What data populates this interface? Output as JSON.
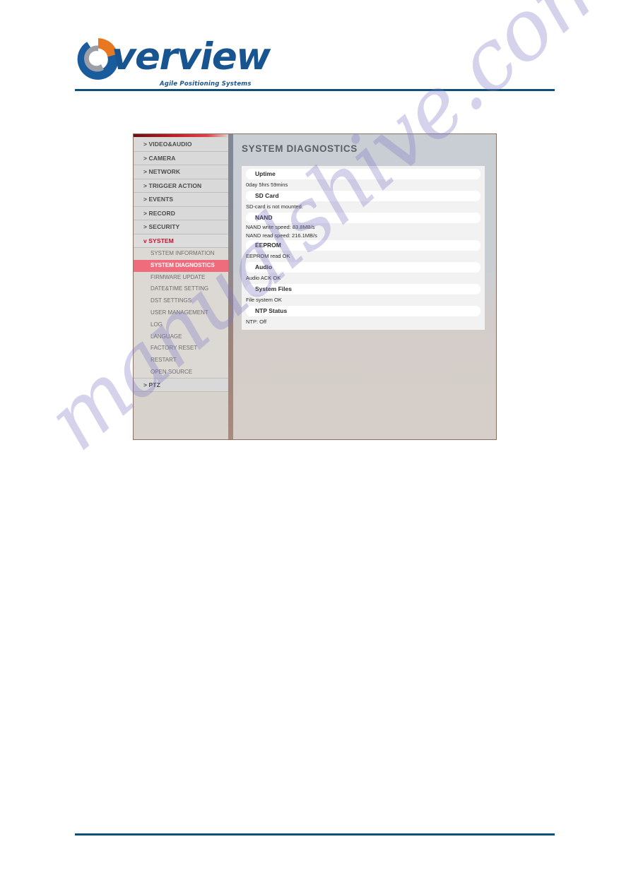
{
  "document": {
    "logo": {
      "wordmark": "verview",
      "tagline": "Agile Positioning Systems",
      "mark_name": "overview-circular-logo-icon",
      "brand_blue": "#18548f",
      "brand_orange": "#e87722"
    },
    "watermark": "manualshive.com",
    "rule_color": "#0d4f76"
  },
  "app": {
    "sidebar": {
      "top_level": [
        {
          "label": "> VIDEO&AUDIO",
          "expanded": false
        },
        {
          "label": "> CAMERA",
          "expanded": false
        },
        {
          "label": "> NETWORK",
          "expanded": false
        },
        {
          "label": "> TRIGGER ACTION",
          "expanded": false
        },
        {
          "label": "> EVENTS",
          "expanded": false
        },
        {
          "label": "> RECORD",
          "expanded": false
        },
        {
          "label": "> SECURITY",
          "expanded": false
        },
        {
          "label": "v SYSTEM",
          "expanded": true
        }
      ],
      "system_children": [
        {
          "label": "SYSTEM INFORMATION",
          "active": false
        },
        {
          "label": "SYSTEM DIAGNOSTICS",
          "active": true
        },
        {
          "label": "FIRMWARE UPDATE",
          "active": false
        },
        {
          "label": "DATE&TIME SETTING",
          "active": false
        },
        {
          "label": "DST SETTINGS",
          "active": false
        },
        {
          "label": "USER MANAGEMENT",
          "active": false
        },
        {
          "label": "LOG",
          "active": false
        },
        {
          "label": "LANGUAGE",
          "active": false
        },
        {
          "label": "FACTORY RESET",
          "active": false
        },
        {
          "label": "RESTART",
          "active": false
        },
        {
          "label": "OPEN SOURCE",
          "active": false
        }
      ],
      "ptz": {
        "label": "> PTZ",
        "expanded": false
      },
      "active_item_color": "#ef6c7c",
      "expanded_item_color": "#c8102e"
    },
    "content": {
      "title": "SYSTEM DIAGNOSTICS",
      "sections": [
        {
          "heading": "Uptime",
          "lines": [
            "0day 5hrs 59mins"
          ]
        },
        {
          "heading": "SD Card",
          "lines": [
            "SD-card is not mounted."
          ]
        },
        {
          "heading": "NAND",
          "lines": [
            "NAND write speed: 83.8MB/s",
            "NAND read speed: 216.1MB/s"
          ]
        },
        {
          "heading": "EEPROM",
          "lines": [
            "EEPROM read OK"
          ]
        },
        {
          "heading": "Audio",
          "lines": [
            "Audio ACK OK"
          ]
        },
        {
          "heading": "System Files",
          "lines": [
            "File system OK"
          ]
        },
        {
          "heading": "NTP Status",
          "lines": [
            "NTP: Off"
          ]
        }
      ]
    }
  }
}
